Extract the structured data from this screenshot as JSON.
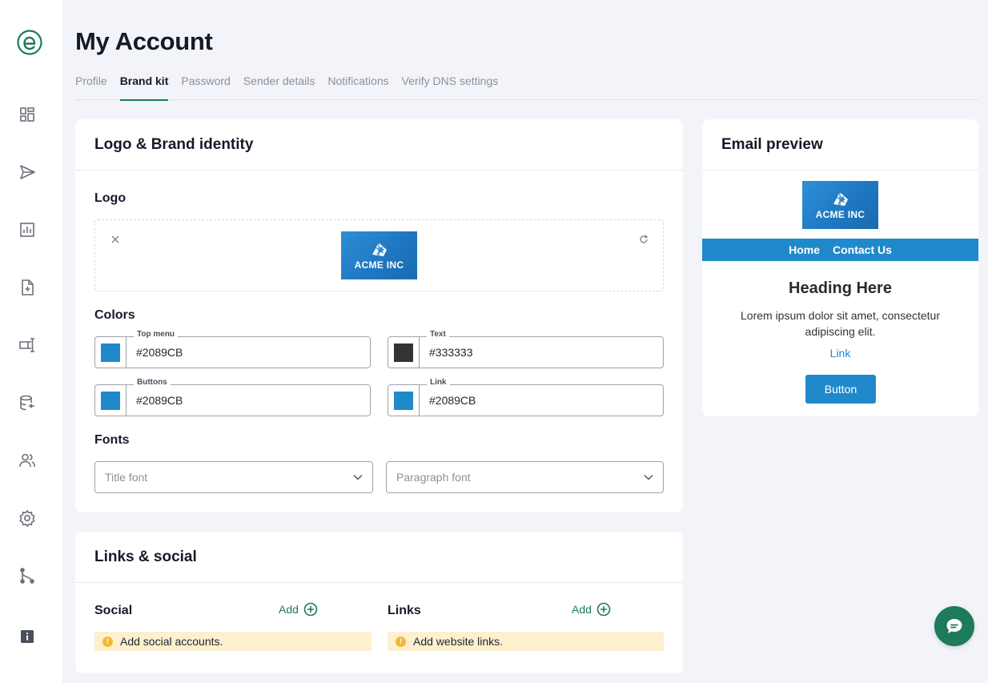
{
  "app": {
    "logo_icon": "e-logo-icon",
    "brand_color": "#1d7a5a"
  },
  "sidebar": {
    "items": [
      {
        "icon": "dashboard-icon"
      },
      {
        "icon": "send-icon"
      },
      {
        "icon": "reports-icon"
      },
      {
        "icon": "add-document-icon"
      },
      {
        "icon": "text-editor-icon"
      },
      {
        "icon": "database-icon"
      },
      {
        "icon": "users-icon"
      },
      {
        "icon": "gear-icon"
      },
      {
        "icon": "workflow-icon"
      },
      {
        "icon": "info-icon"
      }
    ]
  },
  "page": {
    "title": "My Account"
  },
  "tabs": [
    {
      "label": "Profile",
      "active": false
    },
    {
      "label": "Brand kit",
      "active": true
    },
    {
      "label": "Password",
      "active": false
    },
    {
      "label": "Sender details",
      "active": false
    },
    {
      "label": "Notifications",
      "active": false
    },
    {
      "label": "Verify DNS settings",
      "active": false
    }
  ],
  "brand_card": {
    "title": "Logo & Brand identity",
    "logo_label": "Logo",
    "logo_text": "ACME INC",
    "colors_label": "Colors",
    "colors": [
      {
        "label": "Top menu",
        "value": "#2089CB",
        "swatch": "#2089CB"
      },
      {
        "label": "Text",
        "value": "#333333",
        "swatch": "#333333"
      },
      {
        "label": "Buttons",
        "value": "#2089CB",
        "swatch": "#2089CB"
      },
      {
        "label": "Link",
        "value": "#2089CB",
        "swatch": "#2089CB"
      }
    ],
    "fonts_label": "Fonts",
    "title_font_placeholder": "Title font",
    "paragraph_font_placeholder": "Paragraph font"
  },
  "links_card": {
    "title": "Links & social",
    "social_label": "Social",
    "social_add": "Add",
    "social_notice": "Add social accounts.",
    "links_label": "Links",
    "links_add": "Add",
    "links_notice": "Add website links."
  },
  "preview": {
    "title": "Email preview",
    "logo_text": "ACME INC",
    "nav": [
      "Home",
      "Contact Us"
    ],
    "heading": "Heading Here",
    "body": "Lorem ipsum dolor sit amet, consectetur adipiscing elit.",
    "link": "Link",
    "button": "Button"
  },
  "chat": {
    "icon": "chat-icon"
  }
}
